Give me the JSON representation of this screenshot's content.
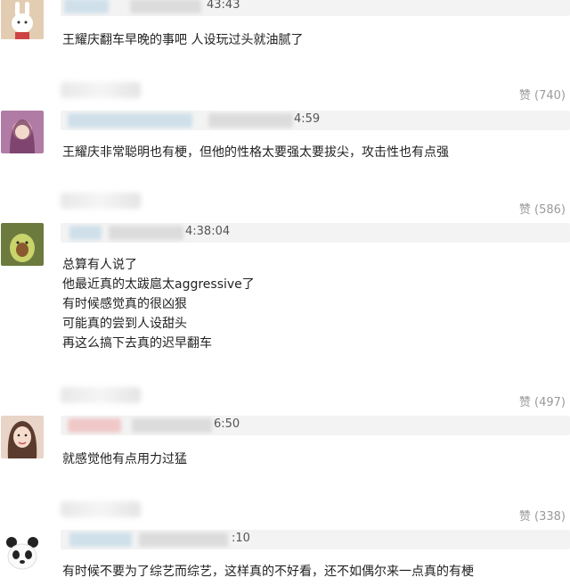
{
  "comments": [
    {
      "time": "43:43",
      "text": "王耀庆翻车早晚的事吧 人设玩过头就油腻了",
      "likes": "赞 (740)"
    },
    {
      "time": "4:59",
      "text": "王耀庆非常聪明也有梗，但他的性格太要强太要拔尖，攻击性也有点强",
      "likes": "赞 (586)"
    },
    {
      "time": "4:38:04",
      "text": "总算有人说了\n他最近真的太跋扈太aggressive了\n有时候感觉真的很凶狠\n可能真的尝到人设甜头\n再这么搞下去真的迟早翻车",
      "likes": "赞 (497)"
    },
    {
      "time": "6:50",
      "text": "就感觉他有点用力过猛",
      "likes": "赞 (338)"
    },
    {
      "time": ":10",
      "text": "有时候不要为了综艺而综艺，这样真的不好看，还不如偶尔来一点真的有梗",
      "likes": ""
    }
  ]
}
